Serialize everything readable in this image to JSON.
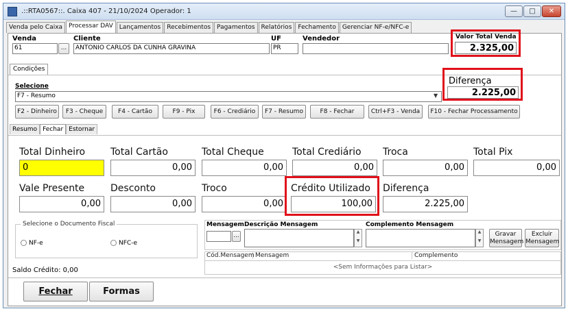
{
  "window": {
    "title": ".::RTA0567::. Caixa 407 - 21/10/2024 Operador: 1",
    "minimize_icon": "minimize-icon",
    "maximize_icon": "maximize-icon",
    "close_icon": "close-icon"
  },
  "main_tabs": [
    "Venda pelo Caixa",
    "Processar DAV",
    "Lançamentos",
    "Recebimentos",
    "Pagamentos",
    "Relatórios",
    "Fechamento",
    "Gerenciar NF-e/NFC-e"
  ],
  "active_main_tab": "Processar DAV",
  "sale": {
    "venda_label": "Venda",
    "venda_value": "61",
    "cliente_label": "Cliente",
    "cliente_value": "ANTONIO CARLOS DA CUNHA GRAVINA",
    "uf_label": "UF",
    "uf_value": "PR",
    "vendedor_label": "Vendedor",
    "vendedor_value": "",
    "valor_total_label": "Valor Total Venda",
    "valor_total_value": "2.325,00",
    "lookup_button": "..."
  },
  "conditions_tab": "Condições",
  "diferenca_top": {
    "label": "Diferença",
    "value": "2.225,00"
  },
  "selecione": {
    "label": "Selecione",
    "value": "F7 - Resumo"
  },
  "function_buttons": [
    "F2 - Dinheiro",
    "F3 - Cheque",
    "F4 - Cartão",
    "F9 - Pix",
    "F6 - Crediário",
    "F7 - Resumo",
    "F8 - Fechar",
    "Ctrl+F3 - Venda",
    "F10 - Fechar Processamento"
  ],
  "sub_tabs": [
    "Resumo",
    "Fechar",
    "Estornar"
  ],
  "active_sub_tab": "Fechar",
  "totals_row1": [
    {
      "label": "Total Dinheiro",
      "value": "0"
    },
    {
      "label": "Total Cartão",
      "value": "0,00"
    },
    {
      "label": "Total Cheque",
      "value": "0,00"
    },
    {
      "label": "Total Crediário",
      "value": "0,00"
    },
    {
      "label": "Troca",
      "value": "0,00"
    },
    {
      "label": "Total Pix",
      "value": "0,00"
    }
  ],
  "totals_row2": [
    {
      "label": "Vale Presente",
      "value": "0,00"
    },
    {
      "label": "Desconto",
      "value": "0,00"
    },
    {
      "label": "Troco",
      "value": "0,00"
    },
    {
      "label": "Crédito Utilizado",
      "value": "100,00"
    },
    {
      "label": "Diferença",
      "value": "2.225,00"
    }
  ],
  "documento_fiscal": {
    "title": "Selecione o Documento Fiscal",
    "options": [
      "NF-e",
      "NFC-e"
    ]
  },
  "mensagem": {
    "mensagem_label": "Mensagem",
    "descricao_label": "Descrição Mensagem",
    "complemento_label": "Complemento Mensagem",
    "gravar_button": "Gravar Mensagem",
    "excluir_button": "Excluir Mensagem",
    "grid_columns": [
      "Cód.Mensagem",
      "Mensagem",
      "Complemento"
    ],
    "empty_text": "<Sem Informações para Listar>"
  },
  "saldo_credito": "Saldo Crédito: 0,00",
  "bottom_buttons": [
    "Fechar",
    "Formas"
  ]
}
